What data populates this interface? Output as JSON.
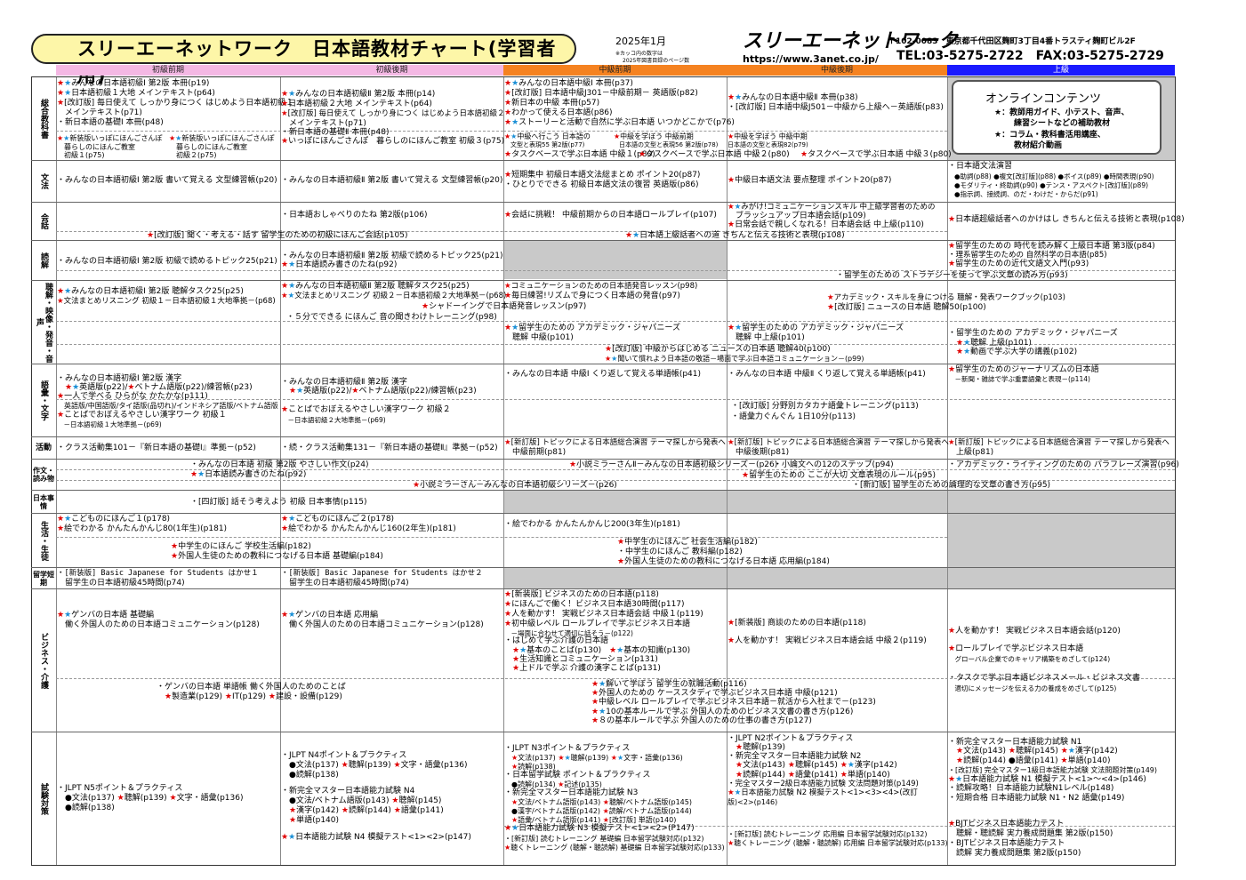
{
  "header": {
    "title": "スリーエーネットワーク　日本語教材チャート(学習者用)",
    "date": "2025年1月",
    "date_note1": "※カッコ内の数字は",
    "date_note2": "2025年図書目録のページ数",
    "logo_text": "スリーエーネットワーク",
    "url": "https://www.3anet.co.jp/",
    "address": "〒102-0083　東京都千代田区麹町3丁目4番トラスティ麹町ビル2F",
    "tel_fax": "TEL:03-5275-2722　FAX:03-5275-2729"
  },
  "levels": [
    "初級前期",
    "初級後期",
    "中級前期",
    "中級後期",
    "上級"
  ],
  "level_colors": [
    "#f4b8e4",
    "#f4b8e4",
    "#f58220",
    "#f58220",
    "#1a1aff"
  ],
  "categories": {
    "sogo": "総合教科書",
    "bunpo": "文法",
    "kaiwa": "会話",
    "dokkai": "読解",
    "choukai": "聴解・映像・発音・音声",
    "goi": "語彙・文字",
    "katsudo": "活動",
    "sakubun": "作文・読み物",
    "jijou": "日本事情",
    "seikatsu": "生活・生徒",
    "ryugaku": "留学短期",
    "business": "ビジネス・介護",
    "shiken": "試験対策"
  },
  "online": {
    "title": "オンラインコンテンツ",
    "l1": "★：教師用ガイド、小テスト、音声、",
    "l2": "練習シートなどの補助教材",
    "l3": "★：コラム・教科書活用講座、",
    "l4": "教材紹介動画"
  },
  "cells": {
    "s1a": "★★みんなの日本語初級Ⅰ 第2版 本冊(p19)",
    "s1b": "★★日本語初級１大地 メインテキスト(p64)",
    "s1c": "★[改訂版] 毎日使えて しっかり身につく はじめよう日本語初級１",
    "s1d": "　メインテキスト(p71)",
    "s1e": "・新日本語の基礎Ⅰ 本冊(p48)",
    "s1f": "★★新装版いっぽにほんごさんぽ",
    "s1g": "　暮らしのにほんご教室",
    "s1h": "　初級１(p75)",
    "s1i": "★★新装版いっぽにほんごさんぽ",
    "s1j": "　暮らしのにほんご教室",
    "s1k": "　初級２(p75)",
    "s2a": "★★みんなの日本語初級Ⅱ 第2版 本冊(p14)",
    "s2b": "★日本語初級２大地 メインテキスト(p64)",
    "s2c": "★[改訂版] 毎日使えて しっかり身につく はじめよう日本語初級２",
    "s2d": "　メインテキスト(p71)",
    "s2e": "・新日本語の基礎Ⅱ 本冊(p48)",
    "s2f": "★いっぽにほんごさんぽ　暮らしのにほんご教室 初級３(p75)",
    "s3a": "★★みんなの日本語中級Ⅰ 本冊(p37)",
    "s3b": "★[改訂版] 日本語中級J301－中級前期－ 英語版(p82)",
    "s3c": "★新日本の中級 本冊(p57)",
    "s3d": "★わかって使える日本語(p86)",
    "s3e": "★★ストーリーと活動で自然に学ぶ日本語 いつかどこかで(p76)",
    "s3f": "★★中級へ行こう 日本語の",
    "s3g": "　文型と表現55 第2版(p77)",
    "s3h": "★中級を学ぼう 中級前期",
    "s3i": "日本語の文型と表現56 第2版(p78)",
    "s3j": "★タスクベースで学ぶ日本語 中級１(p80)",
    "s3k": "★タスクベースで学ぶ日本語 中級２(p80)",
    "s4a": "★★みんなの日本語中級Ⅱ 本冊(p38)",
    "s4b": "・[改訂版] 日本語中級J501－中級から上級へ－英語版(p83)",
    "s4c": "★中級を学ぼう 中級中期",
    "s4d": "日本語の文型と表現82(p79)",
    "s4e": "★タスクベースで学ぶ日本語 中級３(p80)",
    "b1": "・みんなの日本語初級Ⅰ 第2版 書いて覚える 文型練習帳(p20)",
    "b2": "・みんなの日本語初級Ⅱ 第2版 書いて覚える 文型練習帳(p20)",
    "b3a": "★短期集中 初級日本語文法総まとめ ポイント20(p87)",
    "b3b": "・ひとりでできる 初級日本語文法の復習 英語版(p86)",
    "b4": "★中級日本語文法 要点整理 ポイント20(p87)",
    "b5a": "・日本語文法演習",
    "b5b": "●助詞(p88) ●複文[改訂版](p88) ●ボイス(p89) ●時間表現(p90)",
    "b5c": "●モダリティ・終助詞(p90) ●テンス・アスペクト[改訂版](p89)",
    "b5d": "●指示詞、接続詞、のだ・わけだ・からだ(p91)",
    "k1": "・日本語おしゃべりのたね 第2版(p106)",
    "k2": "★会話に挑戦！ 中級前期からの日本語ロールプレイ(p107)",
    "k3a": "★★みがけ!コミュニケーションスキル 中上級学習者のための",
    "k3b": "　ブラッシュアップ日本語会話(p109)",
    "k3c": "★日常会話で親しくなれる！日本語会話 中上級(p110)",
    "k4": "★日本語超級話者へのかけはし きちんと伝える技術と表現(p108)",
    "k5": "★[改訂版] 聞く・考える・話す 留学生のための初級にほんご会話(p105)",
    "k6": "★★日本語上級話者への道 きちんと伝える技術と表現(p108)",
    "d1": "・みんなの日本語初級Ⅰ 第2版 初級で読めるトピック25(p21)",
    "d2a": "・みんなの日本語初級Ⅱ 第2版 初級で読めるトピック25(p21)",
    "d2b": "★★日本語読み書きのたね(p92)",
    "d3a": "★留学生のための 時代を読み解く上級日本語 第3版(p84)",
    "d3b": "・理系留学生のための 自然科学の日本語(p85)",
    "d3c": "★留学生のための近代文語文入門(p93)",
    "d4": "・留学生のための ストラテジーを使って学ぶ文章の読み方(p93)",
    "c1a": "★★みんなの日本語初級Ⅰ 第2版 聴解タスク25(p25)",
    "c1b": "★文法まとめリスニング 初級１－日本語初級１大地準拠－(p68)",
    "c2a": "★★みんなの日本語初級Ⅱ 第2版 聴解タスク25(p25)",
    "c2b": "★★文法まとめリスニング 初級２－日本語初級２大地準拠－(p68)",
    "c3a": "★コミュニケーションのための日本語発音レッスン(p98)",
    "c3b": "★毎日練習!リズムで身につく日本語の発音(p97)",
    "c4": "★シャドーイングで日本語発音レッスン(p97)",
    "c5a": "★アカデミック・スキルを身につける 聴解・発表ワークブック(p103)",
    "c5b": "★[改訂版] ニュースの日本語 聴解50(p100)",
    "c6": "・５分でできる にほんご 音の聞きわけトレーニング(p98)",
    "c7a": "★★留学生のための アカデミック・ジャパニーズ",
    "c7b": "　聴解 中級(p101)",
    "c8a": "★★留学生のための アカデミック・ジャパニーズ",
    "c8b": "　聴解 中上級(p101)",
    "c9a": "・留学生のための アカデミック・ジャパニーズ",
    "c9b": "　★★聴解 上級(p101)",
    "c9c": "　★★動画で学ぶ大学の講義(p102)",
    "c10a": "★[改訂版] 中級からはじめる ニュースの日本語 聴解40(p100)",
    "c10b": "★★聞いて慣れよう日本語の敬語－場面で学ぶ日本語コミュニケーション－(p99)",
    "g1a": "・みんなの日本語初級Ⅰ 第2版 漢字",
    "g1b": "　★★英語版(p22)/★ベトナム語版(p22)/練習帳(p23)",
    "g1c": "★一人で学べる ひらがな かたかな(p111)",
    "g1d": "　英語版/中国語版/タイ語版(品切れ)/インドネシア語版/ベトナム語版",
    "g1e": "★ことばでおぼえるやさしい漢字ワーク 初級１",
    "g1f": "　－日本語初級１大地準拠－(p69)",
    "g2a": "・みんなの日本語初級Ⅱ 第2版 漢字",
    "g2b": "　★★英語版(p22)/★ベトナム語版(p22)/練習帳(p23)",
    "g2c": "★ことばでおぼえるやさしい漢字ワーク 初級２",
    "g2d": "　－日本語初級２大地準拠－(p69)",
    "g3": "・みんなの日本語 中級Ⅰ くり返して覚える単語帳(p41)",
    "g4": "・みんなの日本語 中級Ⅱ くり返して覚える単語帳(p41)",
    "g5": "★留学生のためのジャーナリズムの日本語",
    "g5b": "　－新聞・雑誌で学ぶ重要語彙と表現－(p114)",
    "g6a": "・[改訂版] 分野別カタカナ語彙トレーニング(p113)",
    "g6b": "・語彙力ぐんぐん 1日10分(p113)",
    "a1": "・クラス活動集101－『新日本語の基礎Ⅰ』準拠－(p52)",
    "a2": "・続・クラス活動集131－『新日本語の基礎Ⅱ』準拠－(p52)",
    "a3a": "★[新訂版] トピックによる日本語総合演習 テーマ探しから発表へ",
    "a3b": "　中級前期(p81)",
    "a4a": "★[新訂版] トピックによる日本語総合演習 テーマ探しから発表へ",
    "a4b": "　中級後期(p81)",
    "a5a": "★[新訂版] トピックによる日本語総合演習 テーマ探しから発表へ",
    "a5b": "　上級(p81)",
    "w1": "・みんなの日本語 初級 第2版 やさしい作文(p24)",
    "w2": "★★日本語読み書きのたね(p92)",
    "w3": "★小説ミラーさんⅡ－みんなの日本語初級シリーズ－(p26)",
    "w4": "・小論文への12のステップ(p94)",
    "w5": "・アカデミック・ライティングのための パラフレーズ演習(p96)",
    "w6": "★留学生のための ここが大切 文章表現のルール(p95)",
    "w7": "★小説ミラーさん－みんなの日本語初級シリーズ－(p26)",
    "w8": "・[新訂版] 留学生のための論理的な文章の書き方(p95)",
    "j1": "・[四訂版] 話そう考えよう 初級 日本事情(p115)",
    "l1a": "★★こどものにほんご１(p178)",
    "l1b": "★絵でわかる かんたんかんじ80(1年生)(p181)",
    "l2a": "★★こどものにほんご２(p178)",
    "l2b": "★絵でわかる かんたんかんじ160(2年生)(p181)",
    "l3": "・絵でわかる かんたんかんじ200(3年生)(p181)",
    "l4a": "★中学生のにほんご 学校生活編(p182)",
    "l4b": "★外国人生徒のための教科につなげる日本語 基礎編(p184)",
    "l5a": "★中学生のにほんご 社会生活編(p182)",
    "l5b": "・中学生のにほんご 教科編(p182)",
    "l5c": "★外国人生徒のための教科につなげる日本語 応用編(p184)",
    "r1a": "・[新装版] Basic Japanese for Students はかせ１",
    "r1b": "　留学生の日本語初級45時間(p74)",
    "r2a": "・[新装版] Basic Japanese for Students はかせ２",
    "r2b": "　留学生の日本語初級45時間(p74)",
    "bz1": "★★ゲンバの日本語 基礎編",
    "bz1b": "　働く外国人のための日本語コミュニケーション(p128)",
    "bz2": "★★ゲンバの日本語 応用編",
    "bz2b": "　働く外国人のための日本語コミュニケーション(p128)",
    "bz3a": "★[新装版] ビジネスのための日本語(p118)",
    "bz3b": "★にほんごで働く！ビジネス日本語30時間(p117)",
    "bz3c": "★人を動かす！ 実戦ビジネス日本語会話 中級１(p119)",
    "bz3d": "★初中級レベル ロールプレイで学ぶビジネス日本語",
    "bz3e": "　－場面に合わせて適切に話そう－(p122)",
    "bz3f": "・はじめて学ぶ介護の日本語",
    "bz3g": "　★★基本のことば(p130)　★★基本の知識(p130)",
    "bz3h": "　★生活知識とコミュニケーション(p131)",
    "bz3i": "　★上ドルで学ぶ 介護の漢字ことば(p131)",
    "bz4a": "★[新装版] 商談のための日本語(p118)",
    "bz4b": "★人を動かす！ 実戦ビジネス日本語会話 中級２(p119)",
    "bz5a": "★人を動かす！ 実戦ビジネス日本語会話(p120)",
    "bz5b": "★ロールプレイで学ぶビジネス日本語",
    "bz5c": "　グローバル企業でのキャリア構築をめざして(p124)",
    "bz5d": "・タスクで学ぶ日本語ビジネスメール・ビジネス文書",
    "bz5e": "　適切にメッセージを伝える力の養成をめざして(p125)",
    "bz6a": "・ゲンバの日本語 単語帳 働く外国人のためのことば",
    "bz6b": "　★製造業(p129) ★IT(p129) ★建設・設備(p129)",
    "bz7a": "★★解いて学ぼう 留学生の就職活動(p116)",
    "bz7b": "★外国人のための ケーススタディで学ぶビジネス日本語 中級(p121)",
    "bz7c": "★中級レベル ロールプレイで学ぶビジネス日本語－就活から入社まで－(p123)",
    "bz7d": "★★10の基本ルールで学ぶ 外国人のためのビジネス文書の書き方(p126)",
    "bz7e": "★８の基本ルールで学ぶ 外国人のための仕事の書き方(p127)",
    "e1a": "・JLPT N5ポイント＆プラクティス",
    "e1b": "　●文法(p137) ★聴解(p139) ★文字・語彙(p136)",
    "e1c": "　●読解(p138)",
    "e2a": "・JLPT N4ポイント＆プラクティス",
    "e2b": "　●文法(p137) ★聴解(p139) ★文字・語彙(p136)",
    "e2c": "　●読解(p138)",
    "e2d": "・新完全マスター日本語能力試験 N4",
    "e2e": "　●文法/ベトナム語版(p143) ★聴解(p145)",
    "e2f": "　★漢字(p142) ★読解(p144) ★語彙(p141)",
    "e2g": "　★単語(p140)",
    "e2h": "★★日本語能力試験 N4 模擬テスト<1><2>(p147)",
    "e3a": "・JLPT N3ポイント＆プラクティス",
    "e3b": "　★文法(p137) ★★聴解(p139) ★★文字・語彙(p136)",
    "e3c": "　★読解(p138)",
    "e3d": "・日本留学試験 ポイント＆プラクティス",
    "e3e": "　●読解(p134) ★記述(p135)",
    "e3f": "・新完全マスター日本語能力試験 N3",
    "e3g": "　★文法/ベトナム語版(p143) ★聴解/ベトナム語版(p145)",
    "e3h": "　●漢字/ベトナム語版(p142) ★読解/ベトナム語版(p144)",
    "e3i": "　★語彙/ベトナム語版(p141) ★[改訂版] 単語(p140)",
    "e3j": "★★日本語能力試験 N3 模擬テスト<1><2>(P147)",
    "e3k": "・[新訂版] 読むトレーニング 基礎編 日本留学試験対応(p132)",
    "e3l": "★聴くトレーニング (聴解・聴読解) 基礎編 日本留学試験対応(p133)",
    "e4a": "・JLPT N2ポイント＆プラクティス",
    "e4b": "　★聴解(p139)",
    "e4c": "・新完全マスター日本語能力試験 N2",
    "e4d": "　★文法(p143) ★聴解(p145) ★★漢字(p142)",
    "e4e": "　★読解(p144) ★語彙(p141) ★単語(p140)",
    "e4f": "・完全マスター2級日本語能力試験 文法問題対策(p149)",
    "e4g": "★★日本語能力試験 N2 模擬テスト<1><3><4>(改訂",
    "e4h": "版)<2>(p146)",
    "e4i": "・[新訂版] 読むトレーニング 応用編 日本留学試験対応(p132)",
    "e4j": "★聴くトレーニング (聴解・聴読解) 応用編 日本留学試験対応(p133)",
    "e5a": "・新完全マスター日本語能力試験 N1",
    "e5b": "　★文法(p143) ★聴解(p145) ★★漢字(p142)",
    "e5c": "　★読解(p144) ●語彙(p141) ★単語(p140)",
    "e5d": "・[改訂版] 完全マスター1級日本語能力試験 文法問題対策(p149)",
    "e5e": "★★日本語能力試験 N1 模擬テスト<1>～<4>(p146)",
    "e5f": "・読解攻略！日本語能力試験N1レベル(p148)",
    "e5g": "・短期合格 日本語能力試験 N1・N2 語彙(p149)",
    "e5h": "★BJTビジネス日本語能力テスト",
    "e5i": "　聴解・聴読解 実力養成問題集 第2版(p150)",
    "e5j": "・BJTビジネス日本語能力テスト",
    "e5k": "　読解 実力養成問題集 第2版(p150)"
  }
}
